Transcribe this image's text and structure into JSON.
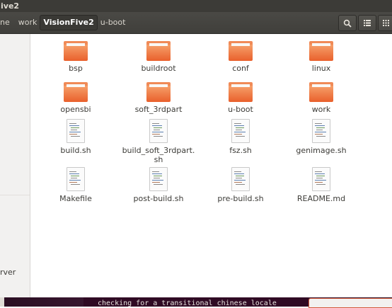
{
  "window": {
    "title": "ive2"
  },
  "breadcrumbs": [
    {
      "label": "ne"
    },
    {
      "label": "work"
    },
    {
      "label": "VisionFive2"
    },
    {
      "label": "u-boot"
    }
  ],
  "header_buttons": [
    "search-icon",
    "list-view-icon",
    "grid-view-icon"
  ],
  "sidebar": {
    "visible_text": "rver"
  },
  "files": [
    {
      "name": "bsp",
      "type": "folder"
    },
    {
      "name": "buildroot",
      "type": "folder"
    },
    {
      "name": "conf",
      "type": "folder"
    },
    {
      "name": "linux",
      "type": "folder"
    },
    {
      "name": "opensbi",
      "type": "folder"
    },
    {
      "name": "soft_3rdpart",
      "type": "folder"
    },
    {
      "name": "u-boot",
      "type": "folder"
    },
    {
      "name": "work",
      "type": "folder"
    },
    {
      "name": "build.sh",
      "type": "file"
    },
    {
      "name": "build_soft_3rdpart.\nsh",
      "type": "file"
    },
    {
      "name": "fsz.sh",
      "type": "file"
    },
    {
      "name": "genimage.sh",
      "type": "file"
    },
    {
      "name": "Makefile",
      "type": "file"
    },
    {
      "name": "post-build.sh",
      "type": "file"
    },
    {
      "name": "pre-build.sh",
      "type": "file"
    },
    {
      "name": "README.md",
      "type": "file"
    }
  ],
  "terminal": {
    "line": "checking for a transitional chinese locale"
  },
  "colors": {
    "folder": "#e9602c",
    "titlebar": "#3c3b37",
    "terminal_bg": "#300a24"
  }
}
